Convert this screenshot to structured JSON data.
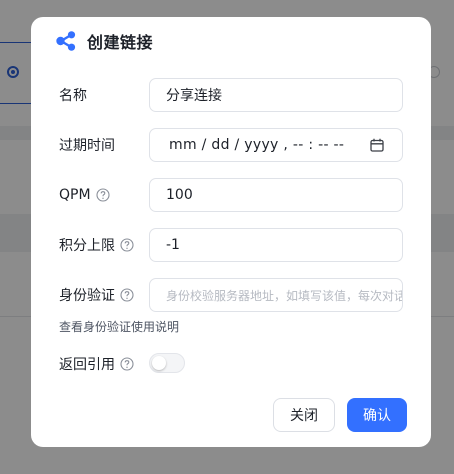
{
  "modal": {
    "title": "创建链接",
    "fields": {
      "name": {
        "label": "名称",
        "value": "分享连接"
      },
      "expire": {
        "label": "过期时间",
        "value": "mm / dd / yyyy ,  -- : --   --"
      },
      "qpm": {
        "label": "QPM",
        "value": "100"
      },
      "points_limit": {
        "label": "积分上限",
        "value": "-1"
      },
      "auth": {
        "label": "身份验证",
        "placeholder": "身份校验服务器地址，如填写该值，每次对话前都会发送"
      }
    },
    "auth_help_link": "查看身份验证使用说明",
    "return_quote": {
      "label": "返回引用",
      "enabled": false
    },
    "buttons": {
      "close": "关闭",
      "confirm": "确认"
    }
  },
  "colors": {
    "primary": "#3370ff",
    "overlay": "rgba(0,0,0,0.45)",
    "text": "#1d2129",
    "placeholder": "#b6bac2"
  },
  "icons": [
    "share-icon",
    "help-circle-icon",
    "calendar-icon"
  ]
}
